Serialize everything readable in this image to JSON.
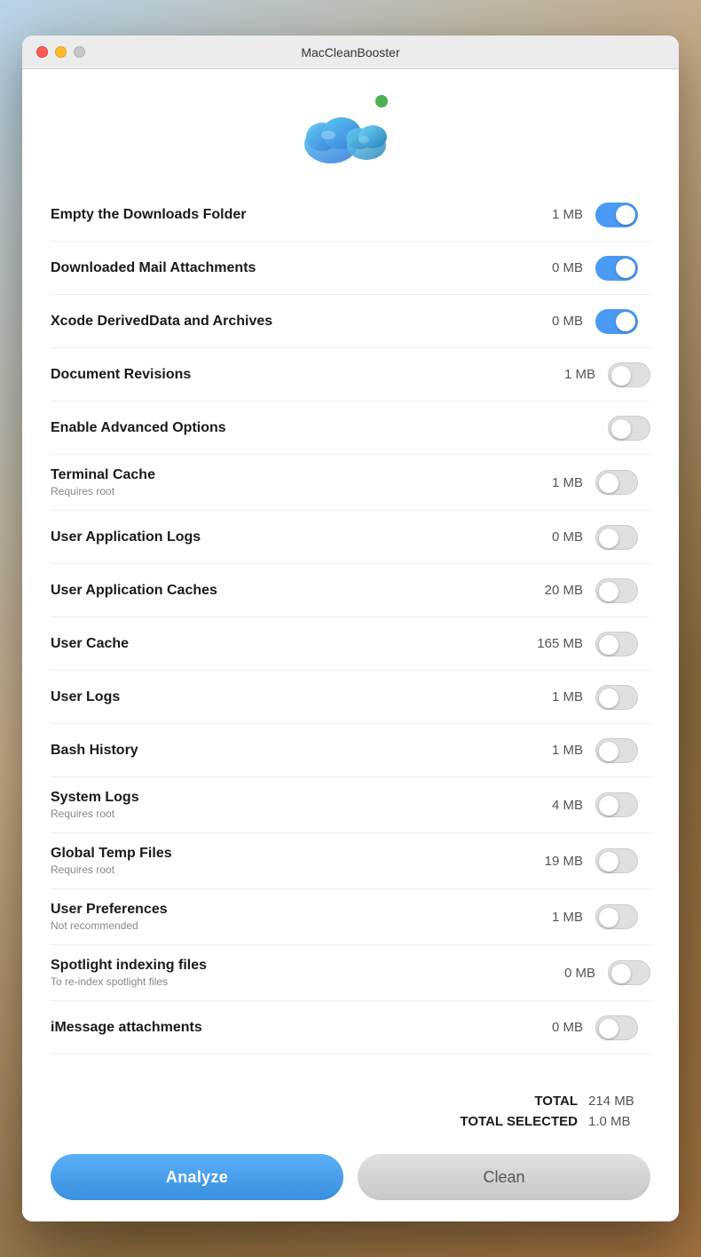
{
  "window": {
    "title": "MacCleanBooster"
  },
  "buttons": {
    "analyze": "Analyze",
    "clean": "Clean"
  },
  "totals": {
    "total_label": "TOTAL",
    "total_value": "214 MB",
    "selected_label": "TOTAL SELECTED",
    "selected_value": "1.0 MB"
  },
  "rows": [
    {
      "id": "empty-downloads",
      "label": "Empty the Downloads Folder",
      "sublabel": "",
      "size": "1 MB",
      "toggle": "on",
      "folder": true
    },
    {
      "id": "mail-attachments",
      "label": "Downloaded Mail Attachments",
      "sublabel": "",
      "size": "0 MB",
      "toggle": "on",
      "folder": true
    },
    {
      "id": "xcode-data",
      "label": "Xcode DerivedData and Archives",
      "sublabel": "",
      "size": "0 MB",
      "toggle": "on",
      "folder": true
    },
    {
      "id": "doc-revisions",
      "label": "Document Revisions",
      "sublabel": "",
      "size": "1 MB",
      "toggle": "off",
      "folder": false
    },
    {
      "id": "advanced-options",
      "label": "Enable Advanced Options",
      "sublabel": "",
      "size": "",
      "toggle": "off",
      "folder": false
    },
    {
      "id": "terminal-cache",
      "label": "Terminal Cache",
      "sublabel": "Requires root",
      "size": "1 MB",
      "toggle": "off",
      "folder": true
    },
    {
      "id": "user-app-logs",
      "label": "User Application Logs",
      "sublabel": "",
      "size": "0 MB",
      "toggle": "off",
      "folder": true
    },
    {
      "id": "user-app-caches",
      "label": "User Application Caches",
      "sublabel": "",
      "size": "20 MB",
      "toggle": "off",
      "folder": true
    },
    {
      "id": "user-cache",
      "label": "User Cache",
      "sublabel": "",
      "size": "165 MB",
      "toggle": "off",
      "folder": true
    },
    {
      "id": "user-logs",
      "label": "User Logs",
      "sublabel": "",
      "size": "1 MB",
      "toggle": "off",
      "folder": true
    },
    {
      "id": "bash-history",
      "label": "Bash History",
      "sublabel": "",
      "size": "1 MB",
      "toggle": "off",
      "folder": true
    },
    {
      "id": "system-logs",
      "label": "System Logs",
      "sublabel": "Requires root",
      "size": "4 MB",
      "toggle": "off",
      "folder": true
    },
    {
      "id": "global-temp",
      "label": "Global Temp Files",
      "sublabel": "Requires root",
      "size": "19 MB",
      "toggle": "off",
      "folder": true
    },
    {
      "id": "user-prefs",
      "label": "User Preferences",
      "sublabel": "Not recommended",
      "size": "1 MB",
      "toggle": "off",
      "folder": true
    },
    {
      "id": "spotlight-indexing",
      "label": "Spotlight indexing files",
      "sublabel": "To re-index spotlight files",
      "size": "0 MB",
      "toggle": "off",
      "folder": false
    },
    {
      "id": "imessage-attachments",
      "label": "iMessage attachments",
      "sublabel": "",
      "size": "0 MB",
      "toggle": "off",
      "folder": true
    }
  ]
}
